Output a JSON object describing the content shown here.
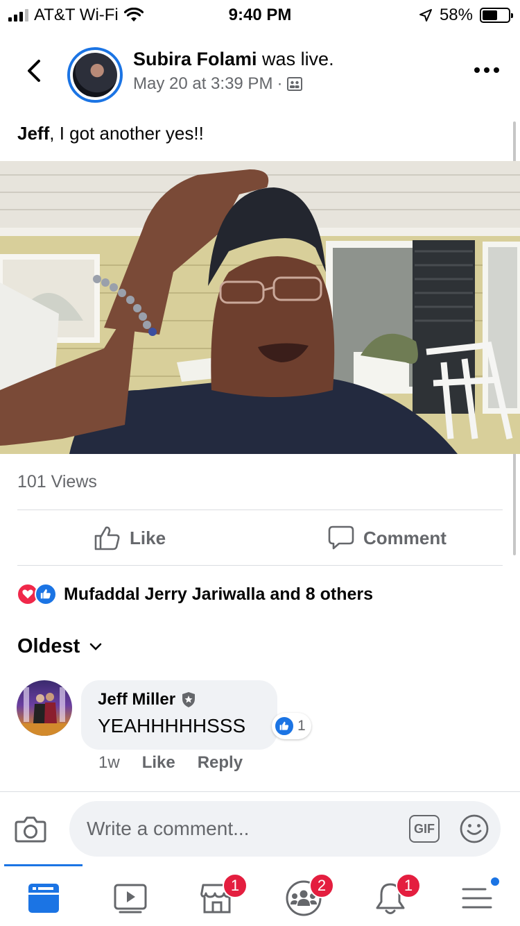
{
  "status_bar": {
    "carrier": "AT&T Wi-Fi",
    "time": "9:40 PM",
    "battery": "58%",
    "battery_level": 0.58
  },
  "post": {
    "author": "Subira Folami",
    "action": " was live.",
    "date": "May 20 at 3:39 PM",
    "separator": "·",
    "caption_bold": "Jeff",
    "caption_rest": ", I got another yes!!",
    "views": "101 Views"
  },
  "actions": {
    "like_label": "Like",
    "comment_label": "Comment"
  },
  "reactions": {
    "text": "Mufaddal Jerry Jariwalla and 8 others"
  },
  "comments": {
    "sort_label": "Oldest",
    "items": [
      {
        "author": "Jeff Miller",
        "text": "YEAHHHHHSSS",
        "reaction_count": "1",
        "time": "1w",
        "like_label": "Like",
        "reply_label": "Reply"
      }
    ]
  },
  "composer": {
    "placeholder": "Write a comment...",
    "gif_label": "GIF"
  },
  "tabs": {
    "marketplace_badge": "1",
    "groups_badge": "2",
    "notifications_badge": "1"
  },
  "colors": {
    "accent": "#1b74e4",
    "badge": "#e41e3f",
    "love": "#f0284a",
    "secondary_text": "#65676b"
  }
}
